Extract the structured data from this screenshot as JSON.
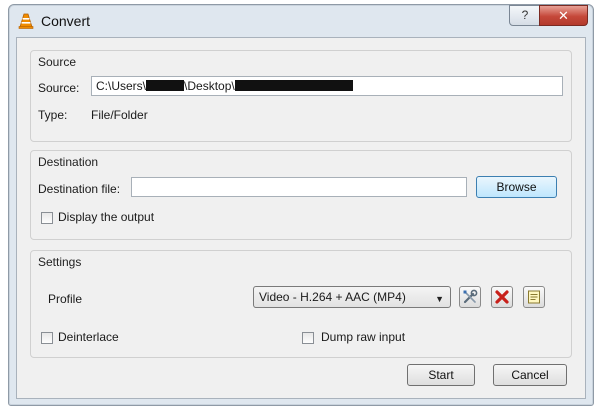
{
  "window": {
    "title": "Convert",
    "help_label": "?",
    "close_label": "✕"
  },
  "source": {
    "group_title": "Source",
    "source_label": "Source:",
    "path_prefix": "C:\\Users\\",
    "path_mid": "\\Desktop\\",
    "type_label": "Type:",
    "type_value": "File/Folder"
  },
  "destination": {
    "group_title": "Destination",
    "file_label": "Destination file:",
    "file_value": "",
    "browse_label": "Browse",
    "display_output_label": "Display the output",
    "display_output_checked": false
  },
  "settings": {
    "group_title": "Settings",
    "profile_label": "Profile",
    "profile_selected": "Video - H.264 + AAC (MP4)",
    "deinterlace_label": "Deinterlace",
    "deinterlace_checked": false,
    "dump_raw_label": "Dump raw input",
    "dump_raw_checked": false,
    "tool_icons": [
      "wrench-screwdriver-icon",
      "red-x-delete-icon",
      "new-profile-icon"
    ]
  },
  "footer": {
    "start_label": "Start",
    "cancel_label": "Cancel"
  },
  "colors": {
    "window_frame": "#dfe7ef",
    "client_bg": "#f0f0f0",
    "close_red": "#c5483a",
    "browse_focus": "#bee6fd",
    "vlc_orange": "#f08c00"
  }
}
